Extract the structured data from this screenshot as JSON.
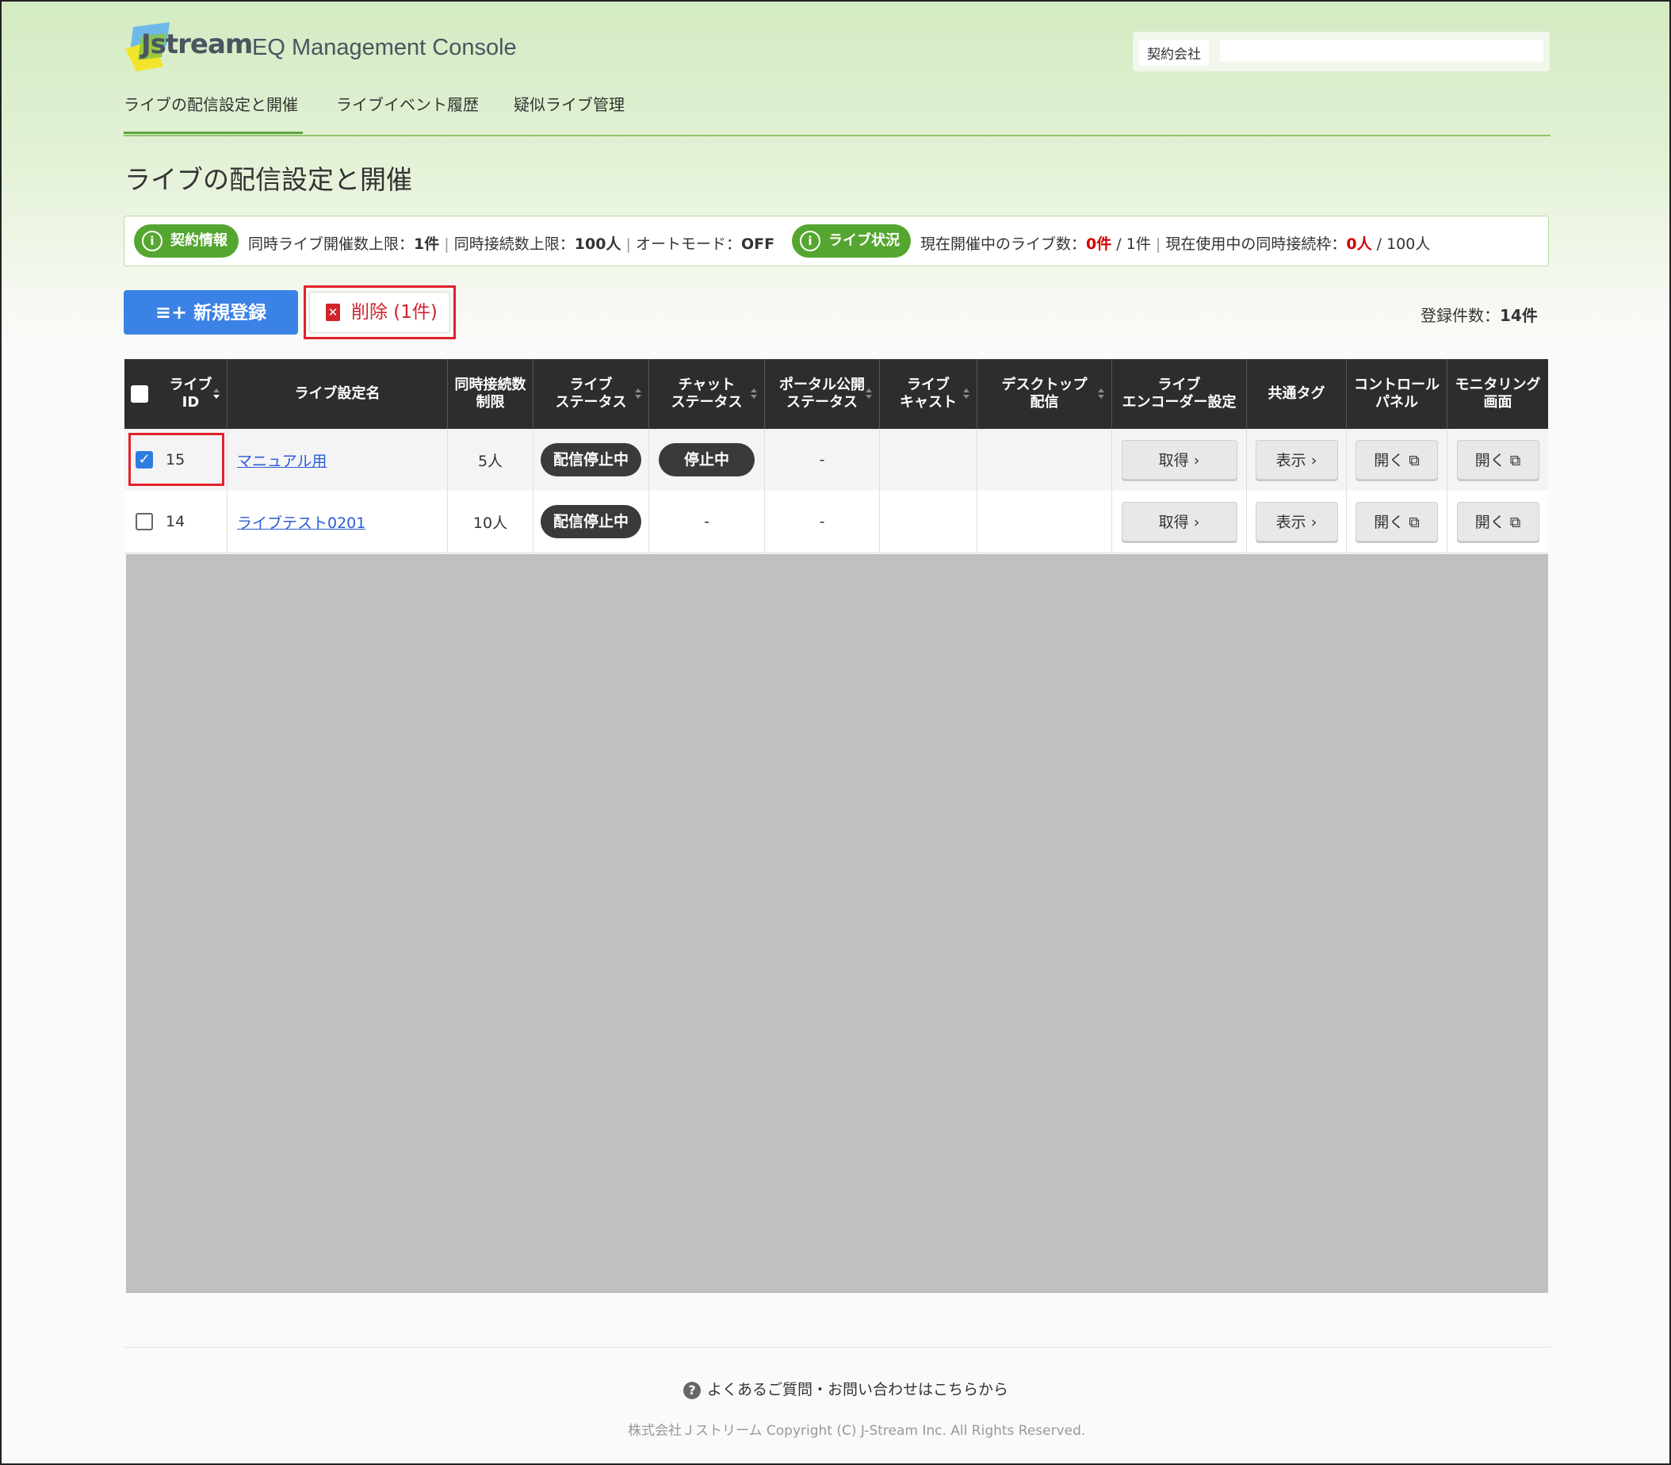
{
  "header": {
    "logo_text": "Jstream",
    "app_title": "EQ Management Console",
    "contract_label": "契約会社",
    "contract_value": ""
  },
  "nav": {
    "items": [
      {
        "label": "ライブの配信設定と開催",
        "active": true
      },
      {
        "label": "ライブイベント履歴",
        "active": false
      },
      {
        "label": "疑似ライブ管理",
        "active": false
      }
    ]
  },
  "page_title": "ライブの配信設定と開催",
  "info": {
    "contract_pill": "契約情報",
    "contract_text_1": "同時ライブ開催数上限：",
    "contract_val_1": "1件",
    "contract_text_2": "同時接続数上限：",
    "contract_val_2": "100人",
    "contract_text_3": "オートモード：",
    "contract_val_3": "OFF",
    "status_pill": "ライブ状況",
    "status_text_1": "現在開催中のライブ数：",
    "status_val_1": "0件",
    "status_total_1": "1件",
    "status_text_2": "現在使用中の同時接続枠：",
    "status_val_2": "0人",
    "status_total_2": "100人"
  },
  "actions": {
    "new_label": "新規登録",
    "delete_label": "削除 (1件)",
    "count_label": "登録件数：",
    "count_value": "14件"
  },
  "table": {
    "headers": [
      "ライブ\nID",
      "ライブ設定名",
      "同時接続数\n制限",
      "ライブ\nステータス",
      "チャット\nステータス",
      "ポータル公開\nステータス",
      "ライブ\nキャスト",
      "デスクトップ\n配信",
      "ライブ\nエンコーダー設定",
      "共通タグ",
      "コントロール\nパネル",
      "モニタリング\n画面"
    ],
    "rows": [
      {
        "checked": true,
        "id": "15",
        "name": "マニュアル用",
        "limit": "5人",
        "live_status": "配信停止中",
        "chat_status": "停止中",
        "portal_status": "-",
        "live_cast": "",
        "desktop": "",
        "encoder_btn": "取得 ›",
        "tag_btn": "表示 ›",
        "control_btn": "開く ⧉",
        "monitor_btn": "開く ⧉"
      },
      {
        "checked": false,
        "id": "14",
        "name": "ライブテスト0201",
        "limit": "10人",
        "live_status": "配信停止中",
        "chat_status": "-",
        "portal_status": "-",
        "live_cast": "",
        "desktop": "",
        "encoder_btn": "取得 ›",
        "tag_btn": "表示 ›",
        "control_btn": "開く ⧉",
        "monitor_btn": "開く ⧉"
      }
    ]
  },
  "footer": {
    "faq": "よくあるご質問・お問い合わせはこちらから",
    "copyright": "株式会社Ｊストリーム Copyright (C) J-Stream Inc. All Rights Reserved."
  },
  "colors": {
    "accent_green": "#55a630",
    "primary_blue": "#3b82e6",
    "danger_red": "#d2232b",
    "header_dark": "#2d2d2d"
  }
}
